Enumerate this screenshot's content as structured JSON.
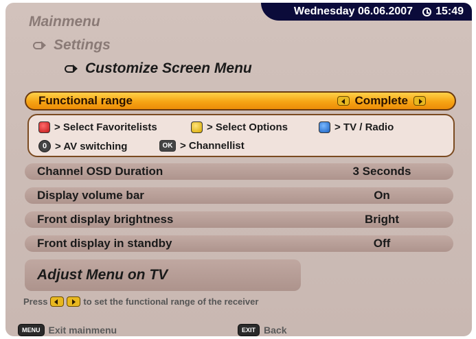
{
  "status_bar": {
    "date": "Wednesday 06.06.2007",
    "time": "15:49"
  },
  "breadcrumb": {
    "level1": "Mainmenu",
    "level2": "Settings",
    "level3": "Customize Screen Menu"
  },
  "functional_range": {
    "label": "Functional range",
    "value": "Complete"
  },
  "legend": {
    "red": "> Select Favoritelists",
    "yellow": "> Select Options",
    "blue": "> TV / Radio",
    "zero_key": "0",
    "zero": "> AV switching",
    "ok_key": "OK",
    "ok": "> Channellist"
  },
  "settings": [
    {
      "label": "Channel OSD Duration",
      "value": "3 Seconds"
    },
    {
      "label": "Display volume bar",
      "value": "On"
    },
    {
      "label": "Front display brightness",
      "value": "Bright"
    },
    {
      "label": "Front display in standby",
      "value": "Off"
    }
  ],
  "adjust_button": "Adjust Menu on TV",
  "hint": {
    "prefix": "Press",
    "suffix": "to set the functional range of the receiver"
  },
  "footer": {
    "menu_key": "MENU",
    "menu_label": "Exit mainmenu",
    "exit_key": "EXIT",
    "exit_label": "Back"
  },
  "colors": {
    "highlight": "#f6a414",
    "date_bar": "#0b0b3a",
    "background": "#cdbdb7"
  }
}
